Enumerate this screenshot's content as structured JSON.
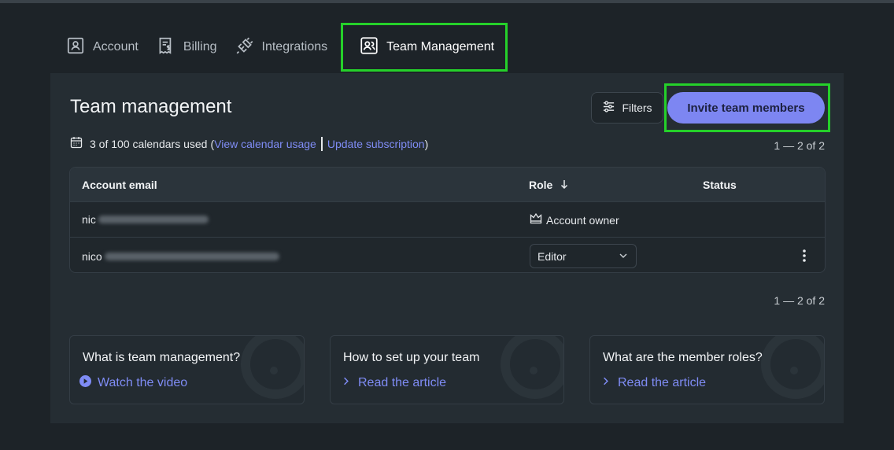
{
  "tabs": [
    {
      "label": "Account",
      "icon": "user-card-icon"
    },
    {
      "label": "Billing",
      "icon": "receipt-icon"
    },
    {
      "label": "Integrations",
      "icon": "plug-icon"
    },
    {
      "label": "Team Management",
      "icon": "team-icon",
      "active": true
    }
  ],
  "page": {
    "title": "Team management",
    "filters_label": "Filters",
    "invite_label": "Invite team members",
    "usage": {
      "text": "3 of 100 calendars used",
      "open_paren": "(",
      "view_link": "View calendar usage",
      "update_link": "Update subscription",
      "close_paren": ")"
    },
    "pager_top": "1 — 2 of 2",
    "pager_bottom": "1 — 2 of 2"
  },
  "table": {
    "headers": {
      "email": "Account email",
      "role": "Role",
      "status": "Status"
    },
    "rows": [
      {
        "email_visible": "nic",
        "role_text": "Account owner"
      },
      {
        "email_visible": "nico",
        "role_select": "Editor"
      }
    ]
  },
  "cards": [
    {
      "title": "What is team management?",
      "link": "Watch the video"
    },
    {
      "title": "How to set up your team",
      "link": "Read the article"
    },
    {
      "title": "What are the member roles?",
      "link": "Read the article"
    }
  ],
  "colors": {
    "accent": "#7d86f2",
    "link": "#7f8cf5",
    "highlight": "#25d02a",
    "background": "#1d2328",
    "panel": "#252d33"
  }
}
